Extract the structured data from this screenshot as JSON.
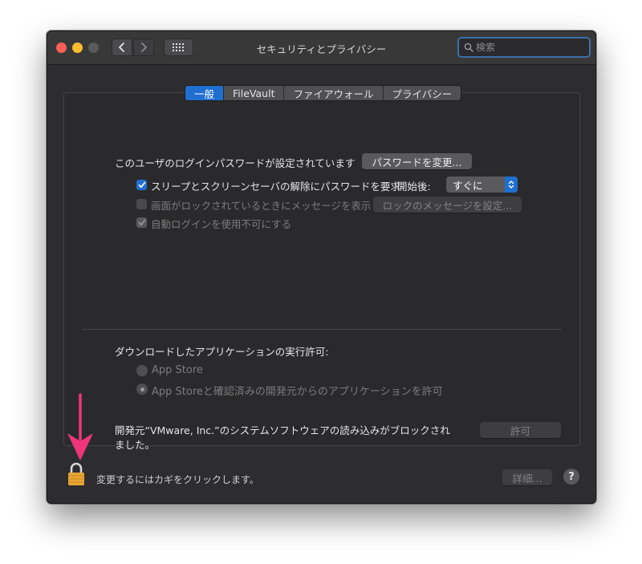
{
  "window": {
    "title": "セキュリティとプライバシー"
  },
  "search": {
    "placeholder": "検索"
  },
  "tabs": [
    {
      "label": "一般",
      "active": true
    },
    {
      "label": "FileVault",
      "active": false
    },
    {
      "label": "ファイアウォール",
      "active": false
    },
    {
      "label": "プライバシー",
      "active": false
    }
  ],
  "general": {
    "password_set_text": "このユーザのログインパスワードが設定されています",
    "change_password_button": "パスワードを変更...",
    "require_password_label": "スリープとスクリーンセーバの解除にパスワードを要求",
    "require_password_checked": true,
    "start_after_label": "開始後:",
    "start_after_value": "すぐに",
    "show_message_label": "画面がロックされているときにメッセージを表示",
    "show_message_checked": false,
    "set_lock_message_button": "ロックのメッセージを設定...",
    "disable_autologin_label": "自動ログインを使用不可にする",
    "disable_autologin_checked": true
  },
  "downloads": {
    "heading": "ダウンロードしたアプリケーションの実行許可:",
    "option_app_store": "App Store",
    "option_identified": "App Storeと確認済みの開発元からのアプリケーションを許可",
    "selected": "identified"
  },
  "blocked": {
    "message_line1": "開発元“VMware, Inc.”のシステムソフトウェアの読み込みがブロックされ",
    "message_line2": "ました。",
    "allow_button": "許可"
  },
  "footer": {
    "lock_text": "変更するにはカギをクリックします。",
    "details_button": "詳細...",
    "help_label": "?"
  },
  "colors": {
    "accent": "#1f6fd1",
    "annotation_arrow": "#f0357a",
    "lock": "#e8a634"
  },
  "icons": {
    "close": "traffic-close-icon",
    "minimize": "traffic-minimize-icon",
    "zoom": "traffic-zoom-icon",
    "back": "chevron-left-icon",
    "forward": "chevron-right-icon",
    "grid": "grid-icon",
    "search": "search-icon",
    "lock": "lock-icon"
  }
}
